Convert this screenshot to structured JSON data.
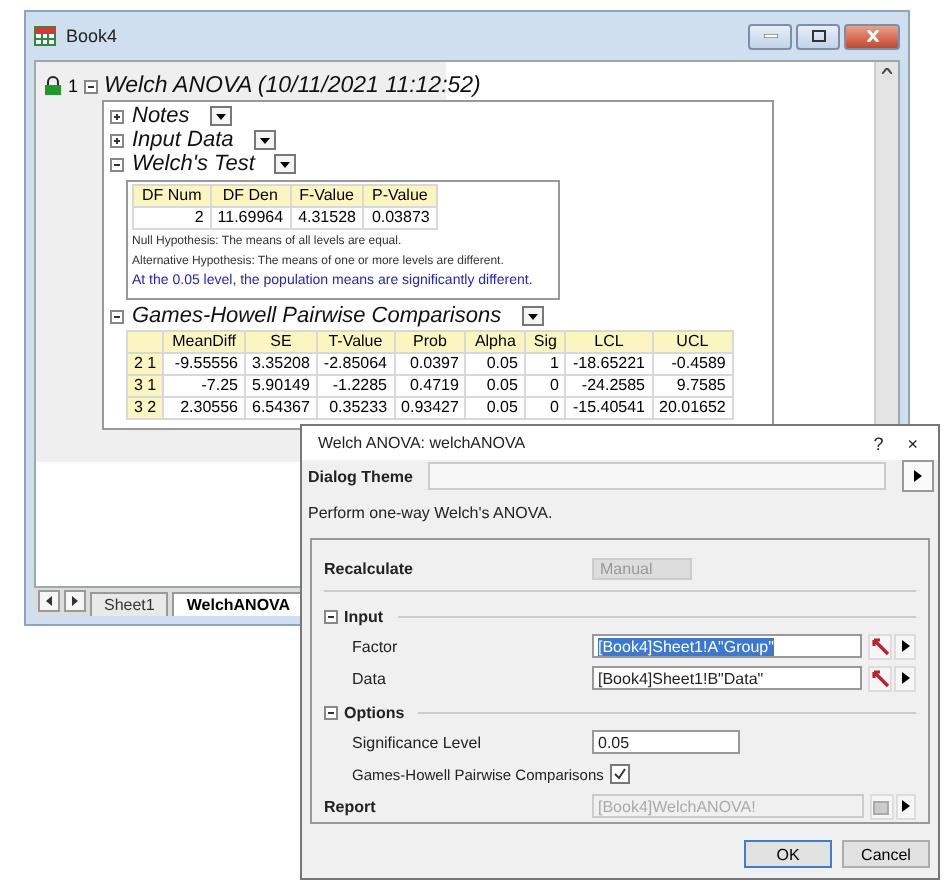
{
  "book_window": {
    "title": "Book4",
    "report": {
      "index": "1",
      "title": "Welch ANOVA (10/11/2021 11:12:52)",
      "expanded": true,
      "sections": [
        {
          "title": "Notes",
          "expanded": false
        },
        {
          "title": "Input Data",
          "expanded": false
        },
        {
          "kind": "test",
          "title": "Welch's Test",
          "expanded": true,
          "columns": [
            "DF Num",
            "DF Den",
            "F-Value",
            "P-Value"
          ],
          "rows": [
            [
              "2",
              "11.69964",
              "4.31528",
              "0.03873"
            ]
          ],
          "notes": [
            "Null Hypothesis: The means of all levels are equal.",
            "Alternative Hypothesis: The means of one or more levels are different."
          ],
          "conclusion": "At the 0.05 level, the population means are significantly different."
        },
        {
          "kind": "comparisons",
          "title": "Games-Howell Pairwise Comparisons",
          "expanded": true,
          "columns": [
            "MeanDiff",
            "SE",
            "T-Value",
            "Prob",
            "Alpha",
            "Sig",
            "LCL",
            "UCL"
          ],
          "rows": [
            {
              "label": "2 1",
              "cells": [
                "-9.55556",
                "3.35208",
                "-2.85064",
                "0.0397",
                "0.05",
                "1",
                "-18.65221",
                "-0.4589"
              ]
            },
            {
              "label": "3 1",
              "cells": [
                "-7.25",
                "5.90149",
                "-1.2285",
                "0.4719",
                "0.05",
                "0",
                "-24.2585",
                "9.7585"
              ]
            },
            {
              "label": "3 2",
              "cells": [
                "2.30556",
                "6.54367",
                "0.35233",
                "0.93427",
                "0.05",
                "0",
                "-15.40541",
                "20.01652"
              ]
            }
          ]
        }
      ]
    },
    "sheet_tabs": [
      {
        "label": "Sheet1",
        "selected": false
      },
      {
        "label": "WelchANOVA",
        "selected": true
      }
    ]
  },
  "dialog": {
    "title": "Welch ANOVA: welchANOVA",
    "help": "?",
    "close": "×",
    "theme_label": "Dialog Theme",
    "description": "Perform one-way Welch's ANOVA.",
    "recalculate": {
      "label": "Recalculate",
      "value": "Manual",
      "disabled": true
    },
    "groups": [
      {
        "title": "Input",
        "expanded": true,
        "rows": [
          {
            "kind": "range",
            "label": "Factor",
            "value": "[Book4]Sheet1!A\"Group\"",
            "selected": true
          },
          {
            "kind": "range",
            "label": "Data",
            "value": "[Book4]Sheet1!B\"Data\"",
            "selected": false
          }
        ]
      },
      {
        "title": "Options",
        "expanded": true,
        "rows": [
          {
            "kind": "text",
            "label": "Significance Level",
            "value": "0.05"
          },
          {
            "kind": "checkbox",
            "label": "Games-Howell Pairwise Comparisons",
            "checked": true
          }
        ]
      }
    ],
    "report": {
      "label": "Report",
      "value": "[Book4]WelchANOVA!",
      "disabled": true
    },
    "buttons": [
      {
        "label": "OK",
        "default": true
      },
      {
        "label": "Cancel",
        "default": false
      }
    ]
  }
}
